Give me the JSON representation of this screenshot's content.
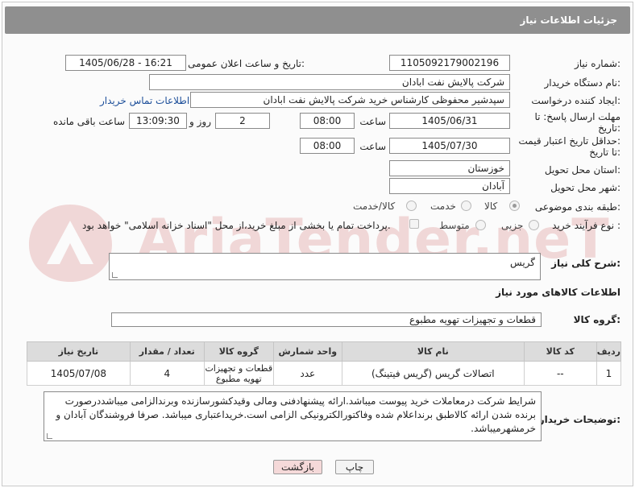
{
  "header": {
    "title": "جزئیات اطلاعات نیاز"
  },
  "form": {
    "need_number": {
      "label": "شماره نیاز:",
      "value": "1105092179002196"
    },
    "announce_date": {
      "label": "تاریخ و ساعت اعلان عمومی:",
      "value": "1405/06/28 - 16:21"
    },
    "buyer_org": {
      "label": "نام دستگاه خریدار:",
      "value": "شرکت پالایش نفت ابادان"
    },
    "creator": {
      "label": "ایجاد کننده درخواست:",
      "value": "سپدشیر محفوظی کارشناس خرید  شرکت پالایش نفت ابادان",
      "contact_link": "اطلاعات تماس خریدار"
    },
    "reply_deadline": {
      "label_line1": "مهلت ارسال پاسخ: تا",
      "label_line2": "تاریخ:",
      "date": "1405/06/31",
      "time_label": "ساعت",
      "time": "08:00",
      "days": "2",
      "days_label": "روز و",
      "remaining": "13:09:30",
      "remaining_label": "ساعت باقی مانده"
    },
    "price_validity": {
      "label_line1": "حداقل تاریخ اعتبار قیمت:",
      "label_line2": "تا تاریخ:",
      "date": "1405/07/30",
      "time_label": "ساعت",
      "time": "08:00"
    },
    "province": {
      "label": "استان محل تحویل:",
      "value": "خوزستان"
    },
    "city": {
      "label": "شهر محل تحویل:",
      "value": "آبادان"
    },
    "category": {
      "label": "طبقه بندی موضوعی:",
      "options": [
        "کالا",
        "خدمت",
        "کالا/خدمت"
      ],
      "selected": "کالا"
    },
    "process": {
      "label": "نوع فرآیند خرید :",
      "options": [
        "جزیی",
        "متوسط"
      ],
      "payment_note": "پرداخت تمام یا بخشی از مبلغ خرید،از محل \"اسناد خزانه اسلامی\" خواهد بود."
    }
  },
  "description": {
    "label": "شرح کلی نیاز:",
    "value": "گریس"
  },
  "goods_info": {
    "title": "اطلاعات کالاهای مورد نیاز"
  },
  "goods_group": {
    "label": "گروه کالا:",
    "value": "قطعات و تجهیزات تهویه مطبوع"
  },
  "table": {
    "headers": [
      "ردیف",
      "کد کالا",
      "نام کالا",
      "واحد شمارش",
      "گروه کالا",
      "تعداد / مقدار",
      "تاریخ نیاز"
    ],
    "rows": [
      [
        "1",
        "--",
        "اتصالات گریس (گریس فیتینگ)",
        "عدد",
        "قطعات و تجهیزات تهویه مطبوع",
        "4",
        "1405/07/08"
      ]
    ]
  },
  "buyer_notes": {
    "label": "توضیحات خریدار:",
    "value": "شرایط شرکت درمعاملات خرید پیوست میباشد.ارائه پیشنهادفنی ومالی وقیدکشورسازنده وبرندالزامی میباشددرصورت برنده شدن ارائه کالاطبق برنداعلام شده وفاکتورالکترونیکی الزامی است.خریداعتباری میباشد. صرفا فروشندگان آبادان و خرمشهرمیباشد."
  },
  "buttons": {
    "print": "چاپ",
    "back": "بازگشت"
  },
  "watermark": {
    "text": "AriaTender.neT"
  }
}
